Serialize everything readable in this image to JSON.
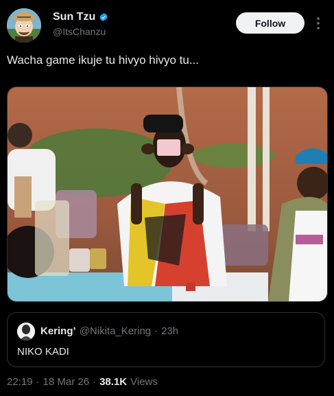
{
  "author": {
    "display_name": "Sun Tzu",
    "handle": "@ItsChanzu",
    "verified_color": "#1d9bf0"
  },
  "follow_label": "Follow",
  "tweet": {
    "text": "Wacha game ikuje tu hivyo hivyo tu..."
  },
  "media": {
    "description_icon": "photo-icon"
  },
  "quote": {
    "name": "Kering’",
    "handle": "@Nikita_Kering",
    "separator": "·",
    "time": "23h",
    "text": "NIKO KADI"
  },
  "meta": {
    "time": "22:19",
    "sep1": "·",
    "date": "18 Mar 26",
    "sep2": "·",
    "views_count": "38.1K",
    "views_label": "Views"
  },
  "colors": {
    "background": "#000000",
    "text_primary": "#e7e9ea",
    "text_secondary": "#71767b",
    "border": "#2f3336",
    "follow_bg": "#eff3f4"
  }
}
